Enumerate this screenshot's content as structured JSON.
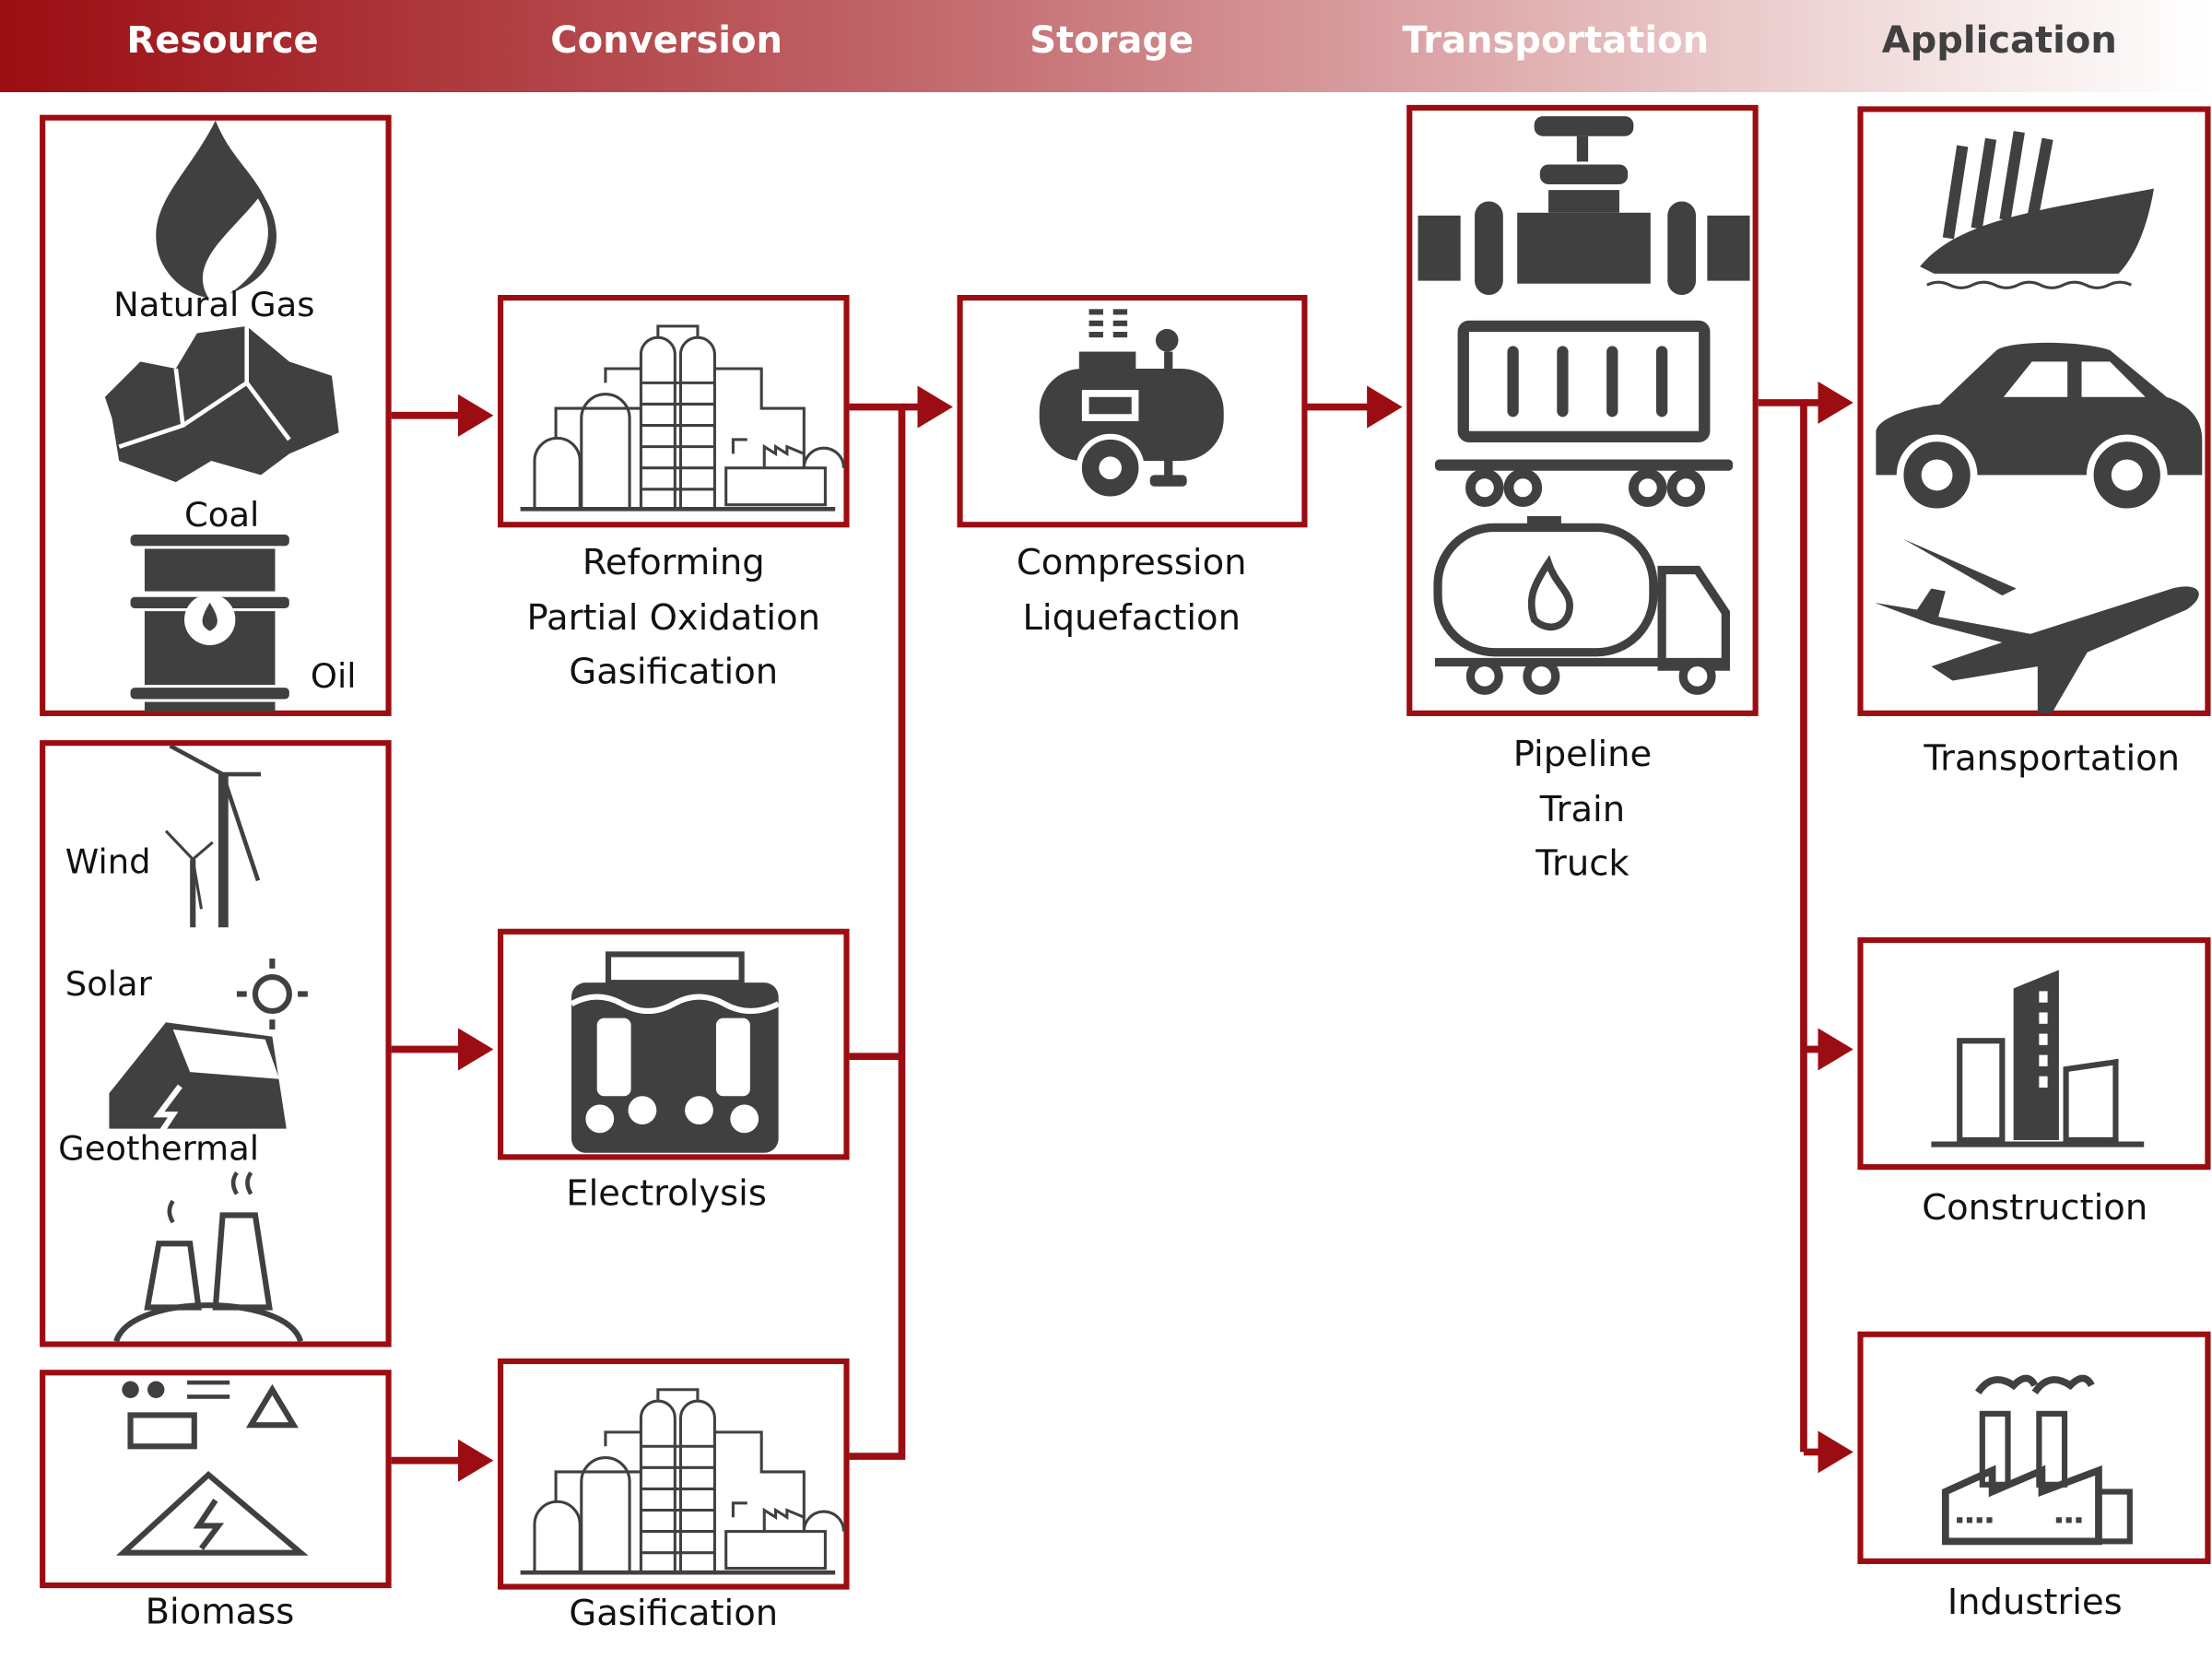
{
  "header": {
    "stages": [
      "Resource",
      "Conversion",
      "Storage",
      "Transportation",
      "Application"
    ],
    "gradient_start": "#9b0d12",
    "gradient_end": "#ffffff",
    "last_label_color": "#404040"
  },
  "colors": {
    "accent": "#9b0d12",
    "icon": "#404040"
  },
  "resource": {
    "fossil": {
      "natural_gas": "Natural Gas",
      "coal": "Coal",
      "oil": "Oil",
      "icons": [
        "flame-icon",
        "coal-icon",
        "oil-barrel-icon"
      ]
    },
    "renewable": {
      "wind": "Wind",
      "solar": "Solar",
      "geothermal": "Geothermal",
      "icons": [
        "wind-turbine-icon",
        "solar-house-icon",
        "geothermal-plant-icon"
      ]
    },
    "biomass": {
      "label": "Biomass",
      "icon": "biomass-icon"
    }
  },
  "conversion": {
    "thermal": {
      "lines": [
        "Reforming",
        "Partial Oxidation",
        "Gasification"
      ],
      "icon": "refinery-icon"
    },
    "electrolysis": {
      "label": "Electrolysis",
      "icon": "electrolyzer-icon"
    },
    "gasification": {
      "label": "Gasification",
      "icon": "refinery-icon"
    }
  },
  "storage": {
    "lines": [
      "Compression",
      "Liquefaction"
    ],
    "icon": "compressor-tank-icon"
  },
  "transportation": {
    "lines": [
      "Pipeline",
      "Train",
      "Truck"
    ],
    "icons": [
      "pipeline-valve-icon",
      "train-wagon-icon",
      "tanker-truck-icon"
    ]
  },
  "application": {
    "transportation": {
      "label": "Transportation",
      "icons": [
        "ship-icon",
        "car-icon",
        "airplane-icon"
      ]
    },
    "construction": {
      "label": "Construction",
      "icon": "buildings-icon"
    },
    "industries": {
      "label": "Industries",
      "icon": "factory-icon"
    }
  }
}
